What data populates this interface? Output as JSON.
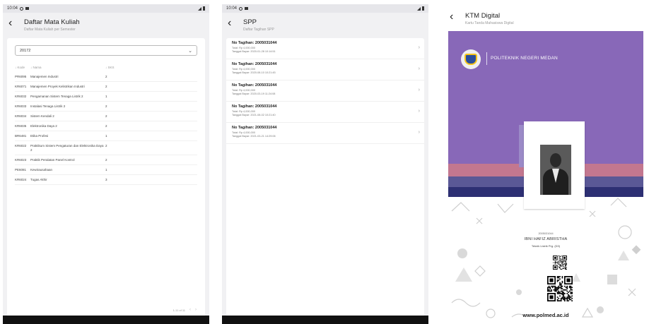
{
  "status_bar": {
    "time": "10:04"
  },
  "courses_screen": {
    "title": "Daftar Mata Kuliah",
    "subtitle": "Daftar Mata Kuliah per Semester",
    "semester_select": "20172",
    "columns": {
      "code": "↓ Kode",
      "name": "↓ Nama",
      "sks": "↓ SKS"
    },
    "rows": [
      {
        "code": "PR6095",
        "name": "Manajemen Industri",
        "sks": "2"
      },
      {
        "code": "KR6071",
        "name": "Manajemen Proyek Kelistrikan Industri",
        "sks": "2"
      },
      {
        "code": "KR6032",
        "name": "Pengamanan Sistem Tenaga Listrik 2",
        "sks": "1"
      },
      {
        "code": "KR6033",
        "name": "Instalasi Tenaga Listrik 2",
        "sks": "2"
      },
      {
        "code": "KR6034",
        "name": "Sistem Kendali 2",
        "sks": "2"
      },
      {
        "code": "KR6035",
        "name": "Elektronika Daya 2",
        "sks": "2"
      },
      {
        "code": "BR6481",
        "name": "Etika Profesi",
        "sks": "1"
      },
      {
        "code": "KR6022",
        "name": "Praktikum Sistem Pengaturan dan Elektronika Daya 2",
        "sks": "2"
      },
      {
        "code": "KR6023",
        "name": "Praktik Peralatan Panel Kontrol",
        "sks": "2"
      },
      {
        "code": "PE6081",
        "name": "Kewirausahaan",
        "sks": "1"
      },
      {
        "code": "KR6024",
        "name": "Tugas Akhir",
        "sks": "3"
      }
    ],
    "pagination": "1-11 of 11"
  },
  "spp_screen": {
    "title": "SPP",
    "subtitle": "Daftar Tagihan SPP",
    "bills": [
      {
        "title": "No Tagihan: 2005031044",
        "total": "Total: Rp 4,000,000",
        "date": "Tanggal Bayar: 2020-01-28 10:14:51"
      },
      {
        "title": "No Tagihan: 2005031044",
        "total": "Total: Rp 4,000,000",
        "date": "Tanggal Bayar: 2020-08-10 10:21:45"
      },
      {
        "title": "No Tagihan: 2005031044",
        "total": "Total: Rp 4,000,000",
        "date": "Tanggal Bayar: 2020-03-19 11:24:08"
      },
      {
        "title": "No Tagihan: 2005031044",
        "total": "Total: Rp 4,000,000",
        "date": "Tanggal Bayar: 2021-08-02 10:21:40"
      },
      {
        "title": "No Tagihan: 2005031044",
        "total": "Total: Rp 4,000,000",
        "date": "Tanggal Bayar: 2021-03-21 14:29:06"
      }
    ]
  },
  "ktm_screen": {
    "title": "KTM Digital",
    "subtitle": "Kartu Tanda Mahasiswa Digital",
    "institution": "POLITEKNIK NEGERI MEDAN",
    "student_id": "2005031044",
    "student_name": "IBNI HAFIZ ABRISTHA",
    "program": "Teknik Listrik Prg. (D3)",
    "website": "www.polmed.ac.id",
    "colors": {
      "purple": "#8868b8",
      "pink": "#c3778f",
      "blue": "#5a5896",
      "navy": "#2d2f73"
    }
  }
}
